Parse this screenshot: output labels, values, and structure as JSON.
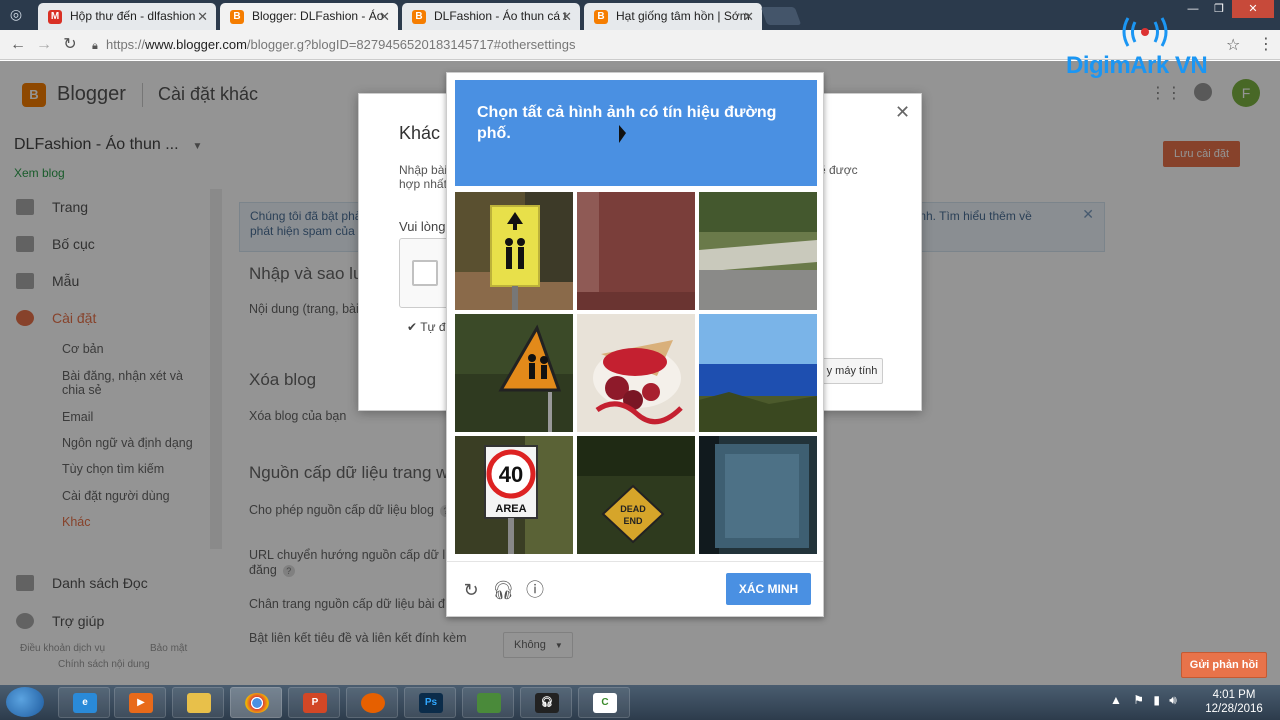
{
  "browser": {
    "tabs": [
      {
        "title": "Hộp thư đến - dlfashion",
        "icon": "gmail-icon"
      },
      {
        "title": "Blogger: DLFashion - Áo",
        "icon": "blogger-icon"
      },
      {
        "title": "DLFashion - Áo thun cá t",
        "icon": "blogger-icon"
      },
      {
        "title": "Hạt giống tâm hồn | Sớm",
        "icon": "blogger-icon"
      }
    ],
    "url_secure": "https://",
    "url_host": "www.blogger.com",
    "url_path": "/blogger.g?blogID=8279456520183145717#othersettings"
  },
  "blogger": {
    "logo_text": "Blogger",
    "page_title": "Cài đặt khác",
    "blog_name": "DLFashion - Áo thun ...",
    "view_blog": "Xem blog",
    "save_label": "Lưu cài đặt",
    "avatar_letter": "F",
    "sidebar": {
      "items": [
        {
          "label": "Trang"
        },
        {
          "label": "Bố cục"
        },
        {
          "label": "Mẫu"
        },
        {
          "label": "Cài đặt"
        }
      ],
      "sub": [
        "Cơ bản",
        "Bài đăng, nhận xét và chia sẻ",
        "Email",
        "Ngôn ngữ và định dạng",
        "Tùy chọn tìm kiếm",
        "Cài đặt người dùng",
        "Khác"
      ],
      "bottom": [
        {
          "label": "Danh sách Đọc"
        },
        {
          "label": "Trợ giúp"
        }
      ],
      "footer_terms": "Điều khoản dịch vụ",
      "footer_privacy": "Bảo mật",
      "footer_content": "Chính sách nội dung"
    },
    "notice": "Chúng tôi đã bật phả",
    "notice_line2": "phát hiện spam của",
    "notice_right": "ính. Tìm hiểu thêm về",
    "sections": {
      "import_title": "Nhập và sao lư",
      "import_desc": "Nội dung (trang, bài",
      "delete_title": "Xóa blog",
      "delete_desc": "Xóa blog của bạn",
      "feed_title": "Nguồn cấp dữ liệu trang w",
      "feed_allow": "Cho phép nguồn cấp dữ liệu blog",
      "feed_redirect": "URL chuyển hướng nguồn cấp dữ li",
      "feed_redirect2": "đăng",
      "feed_footer": "Chân trang nguồn cấp dữ liệu bài đ",
      "feed_links": "Bật liên kết tiêu đề và liên kết đính kèm",
      "dropdown_value": "Không"
    },
    "dialog": {
      "title": "Khác",
      "text1": "Nhập bài",
      "text1b": "hợp nhất",
      "text_right": "ẽ được",
      "please": "Vui lòng",
      "tick": "Tự đ",
      "button": "y máy tính"
    }
  },
  "captcha": {
    "instruction_prefix": "Chọn tất cả hình ảnh có ",
    "instruction_bold": "tín hiệu đường phố",
    "instruction_suffix": ".",
    "verify_label": "XÁC MINH",
    "tiles": [
      "school-crossing-sign",
      "red-wall",
      "grass-road",
      "children-warning-sign",
      "dessert",
      "ocean-coast",
      "speed-limit-40-sign",
      "dead-end-sign",
      "blurry-sign"
    ],
    "speed_text": "40",
    "area_text": "AREA",
    "dead_end_1": "DEAD",
    "dead_end_2": "END"
  },
  "watermark": "DigimArk VN",
  "feedback_label": "Gửi phản hồi",
  "taskbar": {
    "time": "4:01 PM",
    "date": "12/28/2016"
  }
}
